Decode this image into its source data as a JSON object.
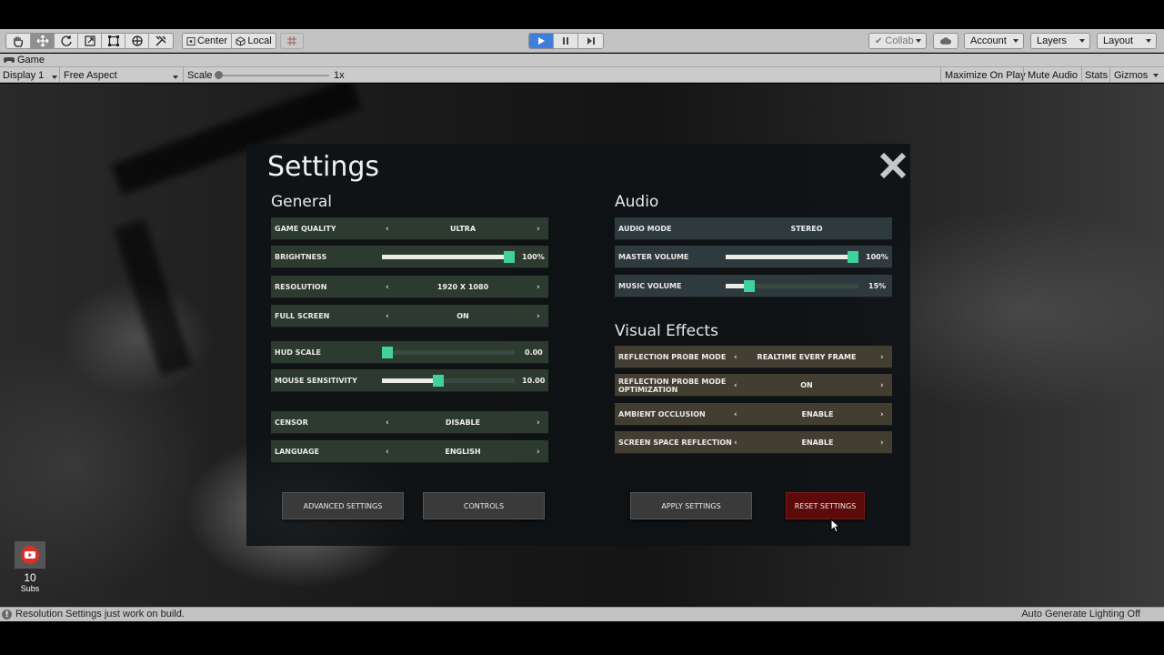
{
  "toolbar": {
    "tools": [
      "hand-tool",
      "move-tool",
      "rotate-tool",
      "scale-tool",
      "rect-tool",
      "transform-tool",
      "custom-tool"
    ],
    "pivot_label": "Center",
    "space_label": "Local",
    "collab_label": "Collab",
    "account_label": "Account",
    "layers_label": "Layers",
    "layout_label": "Layout"
  },
  "game_view": {
    "tab_label": "Game",
    "display_label": "Display 1",
    "aspect_label": "Free Aspect",
    "scale_label": "Scale",
    "scale_value": "1x",
    "maximize_label": "Maximize On Play",
    "mute_label": "Mute Audio",
    "stats_label": "Stats",
    "gizmos_label": "Gizmos"
  },
  "settings": {
    "title": "Settings",
    "general": {
      "title": "General",
      "game_quality": {
        "label": "GAME QUALITY",
        "value": "ULTRA"
      },
      "brightness": {
        "label": "BRIGHTNESS",
        "value": "100%",
        "level": 1.0
      },
      "resolution": {
        "label": "RESOLUTION",
        "value": "1920 X 1080"
      },
      "full_screen": {
        "label": "FULL SCREEN",
        "value": "ON"
      },
      "hud_scale": {
        "label": "HUD SCALE",
        "value": "0.00",
        "level": 0.0
      },
      "mouse_sensitivity": {
        "label": "MOUSE SENSITIVITY",
        "value": "10.00",
        "level": 0.42
      },
      "censor": {
        "label": "CENSOR",
        "value": "DISABLE"
      },
      "language": {
        "label": "LANGUAGE",
        "value": "ENGLISH"
      }
    },
    "audio": {
      "title": "Audio",
      "audio_mode": {
        "label": "AUDIO MODE",
        "value": "STEREO"
      },
      "master_volume": {
        "label": "MASTER VOLUME",
        "value": "100%",
        "level": 1.0
      },
      "music_volume": {
        "label": "MUSIC VOLUME",
        "value": "15%",
        "level": 0.15
      }
    },
    "visual_effects": {
      "title": "Visual Effects",
      "reflection_probe_mode": {
        "label": "REFLECTION PROBE MODE",
        "value": "REALTIME EVERY FRAME"
      },
      "reflection_probe_optimization": {
        "label_line1": "REFLECTION PROBE MODE",
        "label_line2": "OPTIMIZATION",
        "value": "ON"
      },
      "ambient_occlusion": {
        "label": "AMBIENT OCCLUSION",
        "value": "ENABLE"
      },
      "screen_space_reflection": {
        "label": "SCREEN SPACE REFLECTION",
        "value": "ENABLE"
      }
    },
    "buttons": {
      "advanced": "ADVANCED SETTINGS",
      "controls": "CONTROLS",
      "apply": "APPLY SETTINGS",
      "reset": "RESET SETTINGS"
    },
    "arrow_left": "‹",
    "arrow_right": "›"
  },
  "overlay": {
    "yt_count": "10",
    "yt_label": "Subs"
  },
  "status_bar": {
    "message": "Resolution Settings just work on build.",
    "right_text": "Auto Generate Lighting Off"
  },
  "colors": {
    "slider_knob": "#3fd29a",
    "general_row": "#2d3a2f",
    "audio_row": "#2f3a3e",
    "vfx_row": "#433e31",
    "reset_button": "#5c0a0a"
  }
}
